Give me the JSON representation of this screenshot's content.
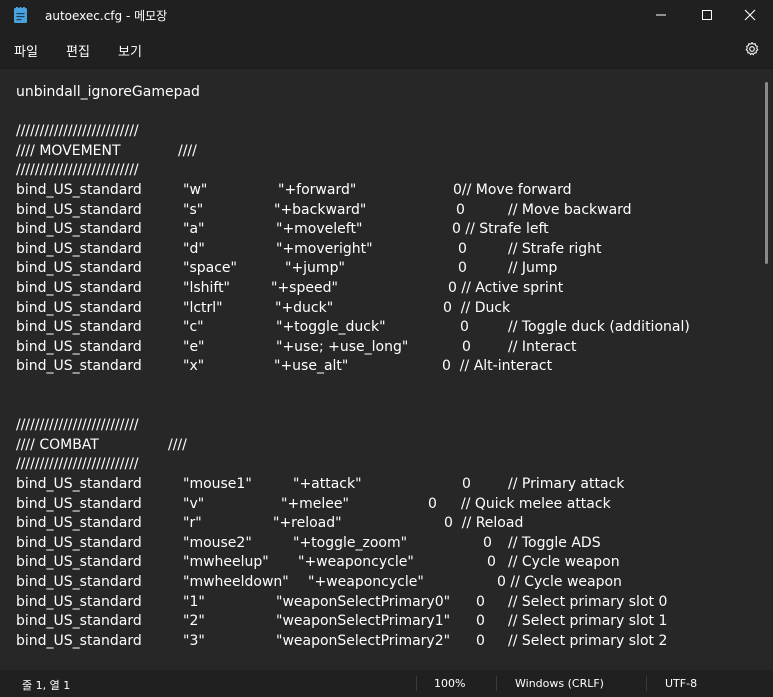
{
  "window": {
    "title": "autoexec.cfg - 메모장",
    "icon": "notepad-icon",
    "controls": [
      "minimize-icon",
      "maximize-icon",
      "close-icon"
    ]
  },
  "menu": {
    "file": "파일",
    "edit": "편집",
    "view": "보기",
    "settings_icon": "gear-icon"
  },
  "lines": [
    {
      "t": [
        "unbindall_ignoreGamepad"
      ]
    },
    {
      "t": [
        ""
      ]
    },
    {
      "t": [
        "//////////////////////////"
      ]
    },
    {
      "t": [
        "//// MOVEMENT",
        "////"
      ]
    },
    {
      "t": [
        "//////////////////////////"
      ]
    },
    {
      "t": [
        "bind_US_standard",
        "\"w\"",
        "\"+forward\"",
        "0// Move forward"
      ]
    },
    {
      "t": [
        "bind_US_standard",
        "\"s\"",
        "\"+backward\"",
        "0",
        "// Move backward"
      ]
    },
    {
      "t": [
        "bind_US_standard",
        "\"a\"",
        "\"+moveleft\"",
        "0 // Strafe left"
      ]
    },
    {
      "t": [
        "bind_US_standard",
        "\"d\"",
        "\"+moveright\"",
        "0",
        "// Strafe right"
      ]
    },
    {
      "t": [
        "bind_US_standard",
        "\"space\"",
        "\"+jump\"",
        "0",
        "// Jump"
      ]
    },
    {
      "t": [
        "bind_US_standard",
        "\"lshift\"",
        "\"+speed\"",
        "0 // Active sprint"
      ]
    },
    {
      "t": [
        "bind_US_standard",
        "\"lctrl\"",
        "\"+duck\"",
        "0  // Duck"
      ]
    },
    {
      "t": [
        "bind_US_standard",
        "\"c\"",
        "\"+toggle_duck\"",
        "0",
        "// Toggle duck (additional)"
      ]
    },
    {
      "t": [
        "bind_US_standard",
        "\"e\"",
        "\"+use; +use_long\"",
        "0",
        "// Interact"
      ]
    },
    {
      "t": [
        "bind_US_standard",
        "\"x\"",
        "\"+use_alt\"",
        "0  // Alt-interact"
      ]
    },
    {
      "t": [
        ""
      ]
    },
    {
      "t": [
        ""
      ]
    },
    {
      "t": [
        "//////////////////////////"
      ]
    },
    {
      "t": [
        "//// COMBAT",
        "////"
      ]
    },
    {
      "t": [
        "//////////////////////////"
      ]
    },
    {
      "t": [
        "bind_US_standard",
        "\"mouse1\"",
        "\"+attack\"",
        "0",
        "// Primary attack"
      ]
    },
    {
      "t": [
        "bind_US_standard",
        "\"v\"",
        "\"+melee\"",
        "0",
        "// Quick melee attack"
      ]
    },
    {
      "t": [
        "bind_US_standard",
        "\"r\"",
        "\"+reload\"",
        "0  // Reload"
      ]
    },
    {
      "t": [
        "bind_US_standard",
        "\"mouse2\"",
        "\"+toggle_zoom\"",
        "0",
        "// Toggle ADS"
      ]
    },
    {
      "t": [
        "bind_US_standard",
        "\"mwheelup\"",
        "\"+weaponcycle\"",
        "0",
        "// Cycle weapon"
      ]
    },
    {
      "t": [
        "bind_US_standard",
        "\"mwheeldown\"",
        "\"+weaponcycle\"",
        "0 // Cycle weapon"
      ]
    },
    {
      "t": [
        "bind_US_standard",
        "\"1\"",
        "\"weaponSelectPrimary0\"",
        "0",
        "// Select primary slot 0"
      ]
    },
    {
      "t": [
        "bind_US_standard",
        "\"2\"",
        "\"weaponSelectPrimary1\"",
        "0",
        "// Select primary slot 1"
      ]
    },
    {
      "t": [
        "bind_US_standard",
        "\"3\"",
        "\"weaponSelectPrimary2\"",
        "0",
        "// Select primary slot 2"
      ]
    }
  ],
  "status": {
    "position": "줄 1, 열 1",
    "zoom": "100%",
    "line_ending": "Windows (CRLF)",
    "encoding": "UTF-8"
  },
  "colors": {
    "background": "#272727",
    "chrome": "#202020",
    "text": "#ffffff"
  }
}
